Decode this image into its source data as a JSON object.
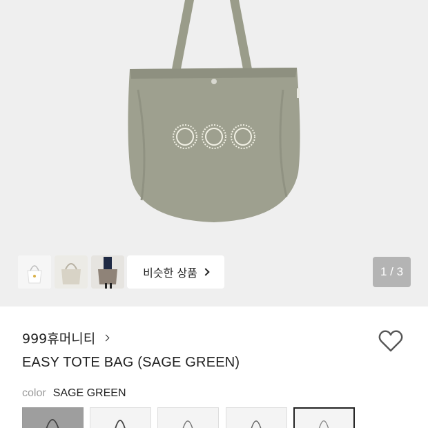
{
  "gallery": {
    "similar_products_label": "비슷한 상품",
    "page_counter": "1 / 3",
    "thumbnails": [
      "thumbnail-1",
      "thumbnail-2",
      "thumbnail-3"
    ]
  },
  "product": {
    "brand": "999휴머니티",
    "title": "EASY TOTE BAG (SAGE GREEN)",
    "color_label": "color",
    "color_value": "SAGE GREEN",
    "swatch_count": 5,
    "selected_swatch": 5
  },
  "colors": {
    "bag": "#9ea08f",
    "bag_shadow": "#8e9080",
    "gallery_bg": "#efefef",
    "counter_bg": "#b4b4b4"
  },
  "icons": {
    "similar": "chevron-right-icon",
    "brand": "chevron-right-icon",
    "wishlist": "heart-outline-icon"
  }
}
